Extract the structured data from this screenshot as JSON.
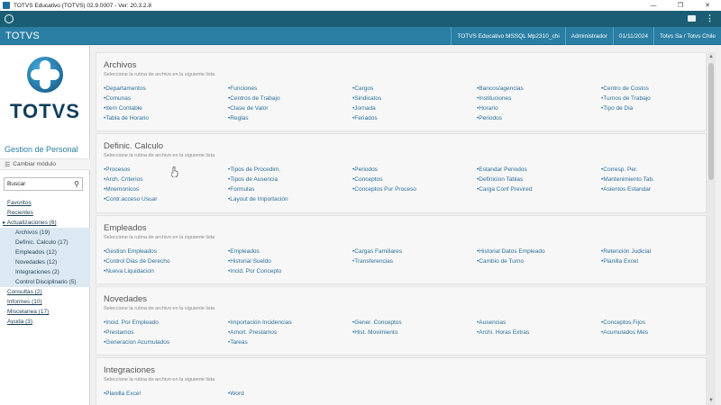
{
  "window": {
    "title": "TOTVS Educativo (TOTVS) 02.9.0007 - Ver: 20.3.2.8",
    "controls": [
      "—",
      "❐",
      "✕"
    ]
  },
  "header": {
    "brand": "TOTVS",
    "environment": "TOTVS Educativo MSSQL Mp2310_chi",
    "user": "Administrador",
    "date": "01/11/2024",
    "company": "Totvs Sa / Totvs Chile"
  },
  "sidebar": {
    "logo_word": "TOTVS",
    "module_title": "Gestion de Personal",
    "change_module": "Cambiar módulo",
    "search_value": "Buscar",
    "tree": [
      {
        "label": "Favoritos",
        "level": 0
      },
      {
        "label": "Recientes",
        "level": 0
      },
      {
        "label": "▸ Actualizaciones (6)",
        "level": "open"
      },
      {
        "label": "Archivos (19)",
        "level": 1
      },
      {
        "label": "Definic. Calculo (17)",
        "level": 1
      },
      {
        "label": "Empleados (12)",
        "level": 1
      },
      {
        "label": "Novedades (12)",
        "level": 1
      },
      {
        "label": "Integraciones (2)",
        "level": 1
      },
      {
        "label": "Control Disciplinario (5)",
        "level": 1
      },
      {
        "label": "Consultas (2)",
        "level": 0
      },
      {
        "label": "Informes (10)",
        "level": 0
      },
      {
        "label": "Miscelanea (17)",
        "level": 0
      },
      {
        "label": "Ayuda (3)",
        "level": 0
      }
    ]
  },
  "sections": [
    {
      "title": "Archivos",
      "subtitle": "Seleccione la rutina de archivo en la siguiente lista",
      "links": [
        "Departamentos",
        "Funciones",
        "Cargos",
        "Bancos/agencias",
        "Centro de Costos",
        "Comunas",
        "Centros de Trabajo",
        "Sindicatos",
        "Instituciones",
        "Turnos de Trabajo",
        "Item Contable",
        "Clase de Valor",
        "Jornada",
        "Horario",
        "Tipo de Dia",
        "Tabla de Horario",
        "Reglas",
        "Feriados",
        "Periodos",
        ""
      ]
    },
    {
      "title": "Definic. Calculo",
      "subtitle": "Seleccione la rutina de archivo en la siguiente lista",
      "links": [
        "Procesos",
        "Tipos de Procedim.",
        "Periodos",
        "Estandar Periodos",
        "Corresp. Per.",
        "Arch. Criterios",
        "Tipos de Ausencia",
        "Conceptos",
        "Definicion Tablas",
        "Mantenimiento Tab.",
        "Mnemonicos",
        "Formulas",
        "Conceptos Por Proceso",
        "Carga Conf Previred",
        "Asientos Estandar",
        "Contr.acceso Usuar",
        "Layout de Importación",
        "",
        "",
        ""
      ]
    },
    {
      "title": "Empleados",
      "subtitle": "Seleccione la rutina de archivo en la siguiente lista",
      "links": [
        "Gestion Empleados",
        "Empleados",
        "Cargas Familiares",
        "Historial Datos Empleado",
        "Retención Judicial",
        "Control Dias de Derecho",
        "Historial Sueldo",
        "Transferencias",
        "Cambio de Turno",
        "Planilla Excel",
        "Nueva Liquidacion",
        "Incid. Por Concepto",
        "",
        "",
        ""
      ]
    },
    {
      "title": "Novedades",
      "subtitle": "Seleccione la rutina de archivo en la siguiente lista",
      "links": [
        "Incid. Por Empleado",
        "Importación Incidencias",
        "Gener. Conceptos",
        "Ausencias",
        "Conceptos Fijos",
        "Prestamos",
        "Amort. Prestamos",
        "Hist. Movimiento",
        "Archi. Horas Extras",
        "Acumulados Mes",
        "Generacion Acumulados",
        "Tareas",
        "",
        "",
        ""
      ]
    },
    {
      "title": "Integraciones",
      "subtitle": "Seleccione la rutina de archivo en la siguiente lista",
      "links": [
        "Planilla Excel",
        "Word",
        "",
        "",
        ""
      ]
    }
  ],
  "colors": {
    "toolbar": "#1b5e73",
    "header": "#2a7ea3",
    "link": "#2b6f9a"
  }
}
